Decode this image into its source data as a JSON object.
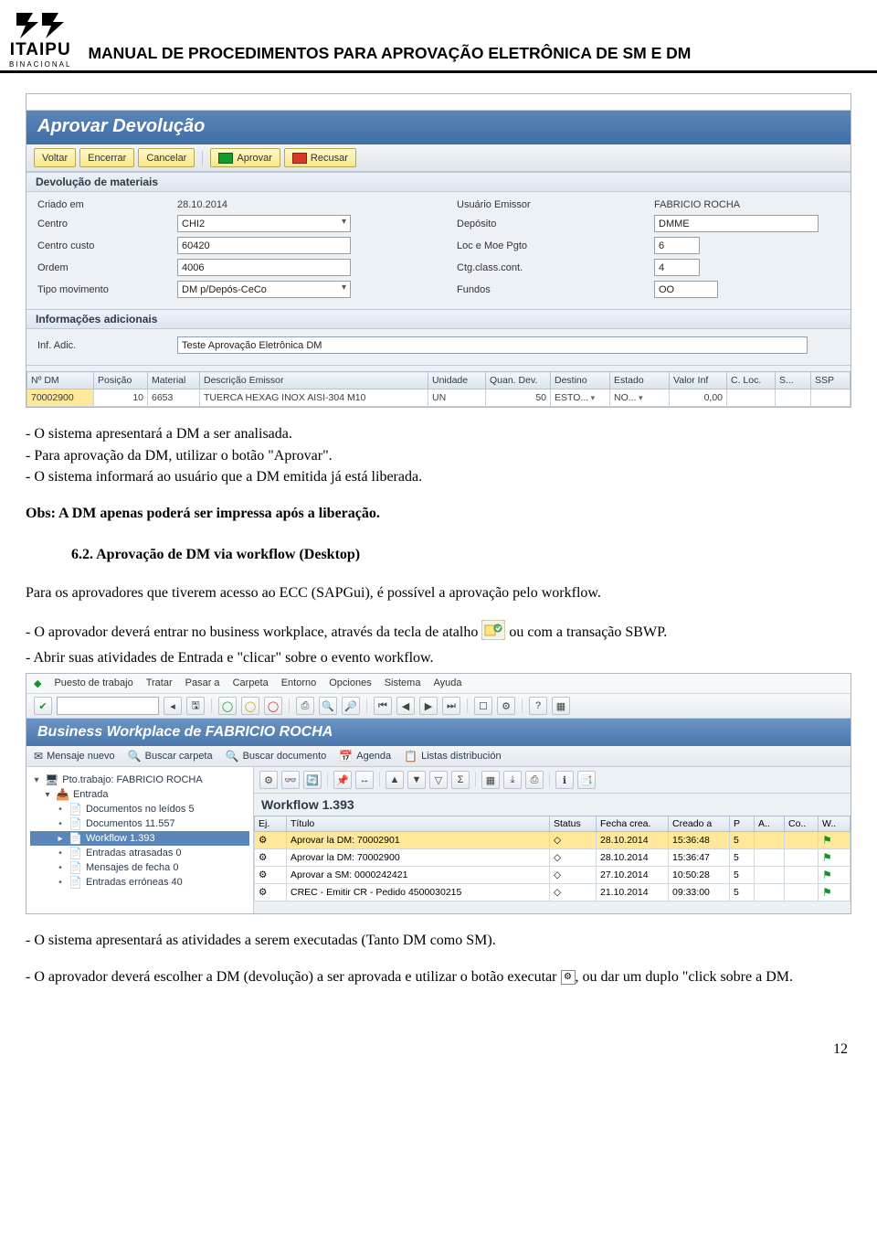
{
  "header": {
    "brand_main": "ITAIPU",
    "brand_sub": "BINACIONAL",
    "doc_title": "MANUAL DE PROCEDIMENTOS PARA APROVAÇÃO ELETRÔNICA DE SM E DM"
  },
  "sap1": {
    "title": "Aprovar Devolução",
    "buttons": {
      "voltar": "Voltar",
      "encerrar": "Encerrar",
      "cancelar": "Cancelar",
      "aprovar": "Aprovar",
      "recusar": "Recusar"
    },
    "panel1": "Devolução de materiais",
    "panel2": "Informações adicionais",
    "form": {
      "criado_em_l": "Criado em",
      "criado_em_v": "28.10.2014",
      "centro_l": "Centro",
      "centro_v": "CHI2",
      "centro_custo_l": "Centro custo",
      "centro_custo_v": "60420",
      "ordem_l": "Ordem",
      "ordem_v": "4006",
      "tipo_mov_l": "Tipo movimento",
      "tipo_mov_v": "DM  p/Depós-CeCo",
      "usuario_l": "Usuário Emissor",
      "usuario_v": "FABRICIO ROCHA",
      "deposito_l": "Depósito",
      "deposito_v": "DMME",
      "locmoe_l": "Loc e Moe Pgto",
      "locmoe_v": "6",
      "ctg_l": "Ctg.class.cont.",
      "ctg_v": "4",
      "fundos_l": "Fundos",
      "fundos_v": "OO",
      "inf_l": "Inf. Adic.",
      "inf_v": "Teste Aprovação Eletrônica DM"
    },
    "cols": {
      "ndm": "Nº DM",
      "pos": "Posição",
      "material": "Material",
      "desc": "Descrição Emissor",
      "unidade": "Unidade",
      "quan": "Quan. Dev.",
      "destino": "Destino",
      "estado": "Estado",
      "valor": "Valor Inf",
      "cloc": "C. Loc.",
      "s": "S...",
      "ssp": "SSP"
    },
    "row": {
      "ndm": "70002900",
      "pos": "10",
      "material": "6653",
      "desc": "TUERCA HEXAG INOX AISI-304 M10",
      "unidade": "UN",
      "quan": "50",
      "destino": "ESTO...",
      "estado": "NO...",
      "valor": "0,00"
    }
  },
  "body": {
    "p1": "- O sistema apresentará a DM a ser analisada.",
    "p2": "- Para aprovação da DM, utilizar o botão \"Aprovar\".",
    "p3": "- O sistema informará ao usuário que a DM emitida já está liberada.",
    "obs": "Obs: A DM apenas poderá ser impressa após a liberação.",
    "sec_num": "6.2. Aprovação de DM via workflow (Desktop)",
    "p4": "Para os aprovadores que tiverem acesso ao ECC (SAPGui), é possível a aprovação pelo workflow.",
    "p5a": "- O aprovador deverá entrar no business workplace, através da tecla de atalho ",
    "p5b": " ou com a transação SBWP.",
    "p6": "- Abrir suas atividades de Entrada e \"clicar\" sobre o evento workflow.",
    "p7": "- O sistema apresentará as atividades a serem executadas (Tanto DM como SM).",
    "p8a": "- O aprovador deverá escolher a DM (devolução) a ser aprovada e utilizar o botão executar ",
    "p8b": ", ou dar um duplo \"click sobre a DM."
  },
  "sap2": {
    "menu": {
      "m1": "Puesto de trabajo",
      "m2": "Tratar",
      "m3": "Pasar a",
      "m4": "Carpeta",
      "m5": "Entorno",
      "m6": "Opciones",
      "m7": "Sistema",
      "m8": "Ayuda"
    },
    "title": "Business Workplace de FABRICIO ROCHA",
    "sub": {
      "s1": "Mensaje nuevo",
      "s2": "Buscar carpeta",
      "s3": "Buscar documento",
      "s4": "Agenda",
      "s5": "Listas distribución"
    },
    "tree": {
      "root": "Pto.trabajo: FABRICIO ROCHA",
      "entrada": "Entrada",
      "docs": "Documentos no leídos 5",
      "docs2": "Documentos 11.557",
      "wf": "Workflow 1.393",
      "atrasadas": "Entradas atrasadas 0",
      "fecha0": "Mensajes de fecha 0",
      "erroneas": "Entradas erróneas 40"
    },
    "wf_title": "Workflow 1.393",
    "wfcols": {
      "ej": "Ej.",
      "titulo": "Título",
      "status": "Status",
      "fecha": "Fecha crea.",
      "creado": "Creado a",
      "p": "P",
      "a": "A..",
      "co": "Co..",
      "w": "W.."
    },
    "wfrows": [
      {
        "t": "Aprovar la DM: 70002901",
        "f": "28.10.2014",
        "h": "15:36:48",
        "p": "5"
      },
      {
        "t": "Aprovar la DM: 70002900",
        "f": "28.10.2014",
        "h": "15:36:47",
        "p": "5"
      },
      {
        "t": "Aprovar a SM: 0000242421",
        "f": "27.10.2014",
        "h": "10:50:28",
        "p": "5"
      },
      {
        "t": "CREC - Emitir CR - Pedido 4500030215",
        "f": "21.10.2014",
        "h": "09:33:00",
        "p": "5"
      }
    ]
  },
  "page_num": "12"
}
